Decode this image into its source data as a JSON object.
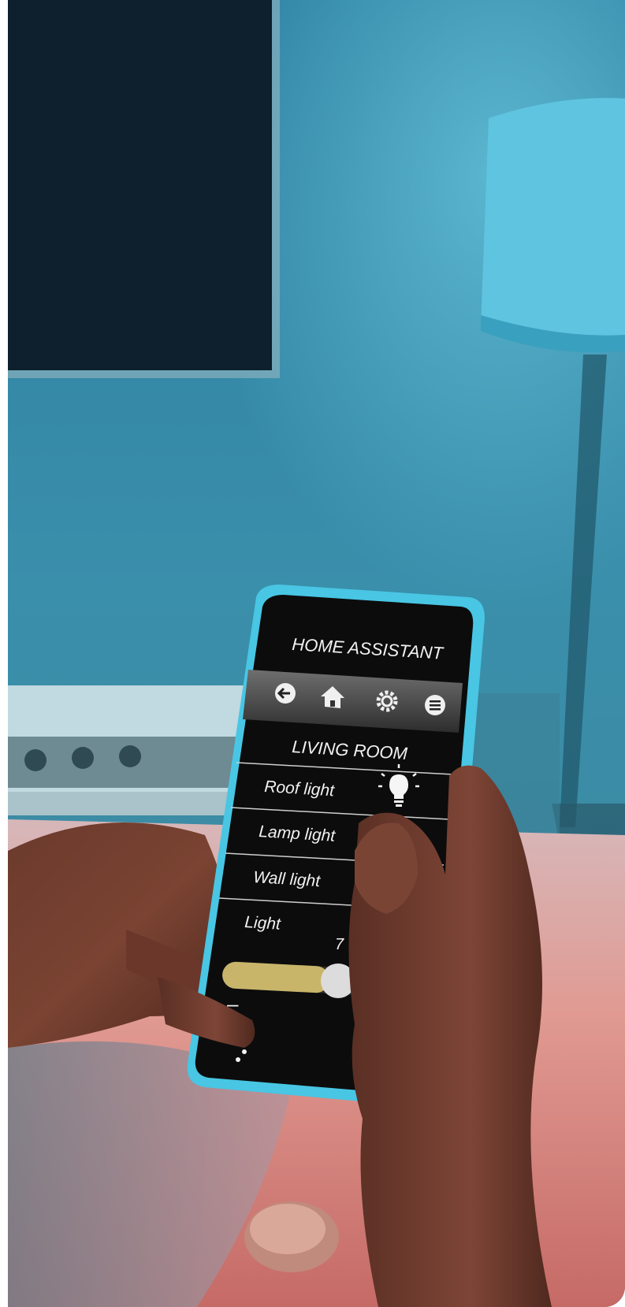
{
  "screen": {
    "app_title": "HOME ASSISTANT",
    "room": "LIVING ROOM",
    "toolbar_icons": [
      "back-arrow-icon",
      "home-icon",
      "gear-icon",
      "menu-icon"
    ],
    "devices": [
      {
        "label": "Roof light",
        "icon": "lightbulb-icon"
      },
      {
        "label": "Lamp light"
      },
      {
        "label": "Wall light"
      },
      {
        "label": "Light"
      }
    ],
    "slider_value_partial": "7",
    "slider_fill_fraction": 0.62,
    "slider_min_label": "–",
    "accent_color": "#c8b56a"
  }
}
